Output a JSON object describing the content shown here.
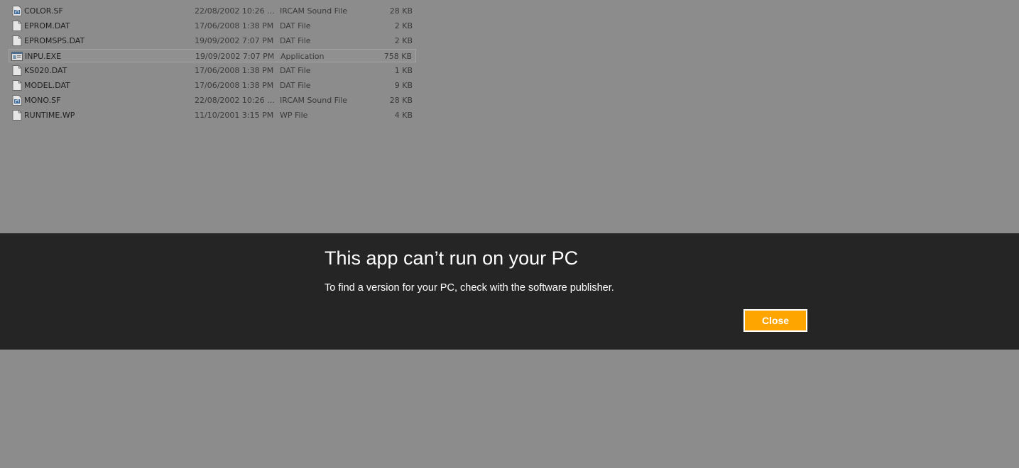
{
  "files": [
    {
      "name": "COLOR.SF",
      "date": "22/08/2002 10:26 ...",
      "type": "IRCAM Sound File",
      "size": "28 KB",
      "icon": "sound-file-icon"
    },
    {
      "name": "EPROM.DAT",
      "date": "17/06/2008 1:38 PM",
      "type": "DAT File",
      "size": "2 KB",
      "icon": "generic-file-icon"
    },
    {
      "name": "EPROMSPS.DAT",
      "date": "19/09/2002 7:07 PM",
      "type": "DAT File",
      "size": "2 KB",
      "icon": "generic-file-icon"
    },
    {
      "name": "INPU.EXE",
      "date": "19/09/2002 7:07 PM",
      "type": "Application",
      "size": "758 KB",
      "icon": "application-icon",
      "selected": true
    },
    {
      "name": "KS020.DAT",
      "date": "17/06/2008 1:38 PM",
      "type": "DAT File",
      "size": "1 KB",
      "icon": "generic-file-icon"
    },
    {
      "name": "MODEL.DAT",
      "date": "17/06/2008 1:38 PM",
      "type": "DAT File",
      "size": "9 KB",
      "icon": "generic-file-icon"
    },
    {
      "name": "MONO.SF",
      "date": "22/08/2002 10:26 ...",
      "type": "IRCAM Sound File",
      "size": "28 KB",
      "icon": "sound-file-icon"
    },
    {
      "name": "RUNTIME.WP",
      "date": "11/10/2001 3:15 PM",
      "type": "WP File",
      "size": "4 KB",
      "icon": "generic-file-icon"
    }
  ],
  "dialog": {
    "title": "This app can’t run on your PC",
    "message": "To find a version for your PC, check with the software publisher.",
    "close_label": "Close"
  },
  "colors": {
    "overlay_background": "#8c8c8c",
    "dialog_background": "#252525",
    "close_button": "#ffa500"
  }
}
